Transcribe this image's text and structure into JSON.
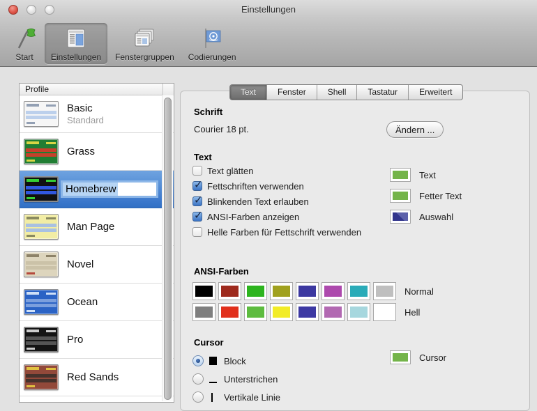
{
  "window": {
    "title": "Einstellungen"
  },
  "toolbar": {
    "items": [
      {
        "label": "Start",
        "icon": "start-flag-icon",
        "selected": false
      },
      {
        "label": "Einstellungen",
        "icon": "settings-window-icon",
        "selected": true
      },
      {
        "label": "Fenstergruppen",
        "icon": "window-group-icon",
        "selected": false
      },
      {
        "label": "Codierungen",
        "icon": "encodings-flag-icon",
        "selected": false
      }
    ]
  },
  "profile_list": {
    "header": "Profile",
    "items": [
      {
        "name": "Basic",
        "subtitle": "Standard",
        "selected": false,
        "thumb": {
          "bg": "#f6f6f6",
          "text": "#93a0b4",
          "row": "#bcd0ec",
          "footer": "#93a0b4"
        }
      },
      {
        "name": "Grass",
        "subtitle": "",
        "selected": false,
        "thumb": {
          "bg": "#207d33",
          "text": "#d8d544",
          "row": "#c7402b",
          "footer": "#d8d544"
        }
      },
      {
        "name": "Homebrew",
        "subtitle": "",
        "selected": true,
        "editing": true,
        "thumb": {
          "bg": "#101010",
          "text": "#35cf35",
          "row": "#3157de",
          "footer": "#35cf35"
        }
      },
      {
        "name": "Man Page",
        "subtitle": "",
        "selected": false,
        "thumb": {
          "bg": "#f2eda4",
          "text": "#8a8a60",
          "row": "#a9c1e2",
          "footer": "#8a8a60"
        }
      },
      {
        "name": "Novel",
        "subtitle": "",
        "selected": false,
        "thumb": {
          "bg": "#ddd5bd",
          "text": "#8d8268",
          "row": "#cbc2a8",
          "footer": "#b54a3c"
        }
      },
      {
        "name": "Ocean",
        "subtitle": "",
        "selected": false,
        "thumb": {
          "bg": "#2b63c5",
          "text": "#cfe0f7",
          "row": "#7b9fdd",
          "footer": "#cfe0f7"
        }
      },
      {
        "name": "Pro",
        "subtitle": "",
        "selected": false,
        "thumb": {
          "bg": "#141414",
          "text": "#cccccc",
          "row": "#555555",
          "footer": "#cccccc"
        }
      },
      {
        "name": "Red Sands",
        "subtitle": "",
        "selected": false,
        "thumb": {
          "bg": "#92493a",
          "text": "#e0c040",
          "row": "#45322c",
          "footer": "#e0c040"
        }
      }
    ]
  },
  "tabs": [
    {
      "label": "Text",
      "selected": true
    },
    {
      "label": "Fenster",
      "selected": false
    },
    {
      "label": "Shell",
      "selected": false
    },
    {
      "label": "Tastatur",
      "selected": false
    },
    {
      "label": "Erweitert",
      "selected": false
    }
  ],
  "font_section": {
    "header": "Schrift",
    "value": "Courier 18 pt.",
    "change_button": "Ändern ..."
  },
  "text_section": {
    "header": "Text",
    "checkboxes": [
      {
        "label": "Text glätten",
        "checked": false
      },
      {
        "label": "Fettschriften verwenden",
        "checked": true
      },
      {
        "label": "Blinkenden Text erlauben",
        "checked": true
      },
      {
        "label": "ANSI-Farben anzeigen",
        "checked": true
      },
      {
        "label": "Helle Farben für Fettschrift verwenden",
        "checked": false
      }
    ],
    "color_wells": [
      {
        "label": "Text",
        "color": "#74b44a",
        "split": false
      },
      {
        "label": "Fetter Text",
        "color": "#74b44a",
        "split": false
      },
      {
        "label": "Auswahl",
        "color": "#32358c",
        "color2": "#5d62ab",
        "split": true
      }
    ]
  },
  "ansi_section": {
    "header": "ANSI-Farben",
    "rows": [
      {
        "label": "Normal",
        "colors": [
          "#000000",
          "#9e2a1d",
          "#2db41e",
          "#a0a11f",
          "#3c38a0",
          "#ad49ad",
          "#2aabb8",
          "#bfbfbf"
        ]
      },
      {
        "label": "Hell",
        "colors": [
          "#7f7f7f",
          "#e1301c",
          "#5dbc3f",
          "#f2ec27",
          "#3d39a3",
          "#b269b2",
          "#a6d7de",
          "#ffffff"
        ]
      }
    ]
  },
  "cursor_section": {
    "header": "Cursor",
    "options": [
      {
        "label": "Block",
        "glyph": "block-cursor-icon",
        "selected": true
      },
      {
        "label": "Unterstrichen",
        "glyph": "underline-cursor-icon",
        "selected": false
      },
      {
        "label": "Vertikale Linie",
        "glyph": "vertical-line-cursor-icon",
        "selected": false
      }
    ],
    "color_well": {
      "label": "Cursor",
      "color": "#74b44a"
    }
  }
}
